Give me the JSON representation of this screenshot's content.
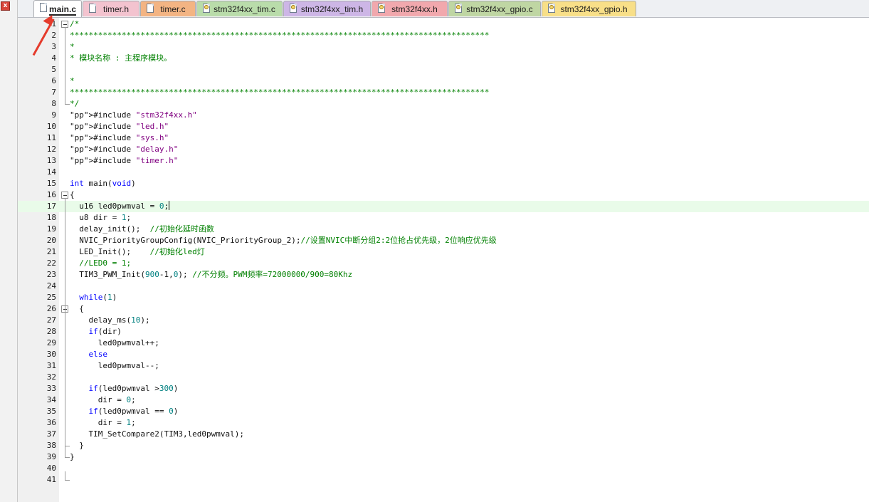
{
  "window": {
    "close_glyph": "x"
  },
  "tabs": [
    {
      "label": "main.c",
      "active": true,
      "color": "#ffffff",
      "icon": "file-icon"
    },
    {
      "label": "timer.h",
      "color": "#f3c3cf",
      "icon": "file-icon"
    },
    {
      "label": "timer.c",
      "color": "#f3b483",
      "icon": "file-icon"
    },
    {
      "label": "stm32f4xx_tim.c",
      "color": "#b9dcaa",
      "icon": "locked-file-icon"
    },
    {
      "label": "stm32f4xx_tim.h",
      "color": "#cdb6e6",
      "icon": "locked-file-icon"
    },
    {
      "label": "stm32f4xx.h",
      "color": "#f1a8ad",
      "icon": "locked-file-icon"
    },
    {
      "label": "stm32f4xx_gpio.c",
      "color": "#bfd6a3",
      "icon": "locked-file-icon"
    },
    {
      "label": "stm32f4xx_gpio.h",
      "color": "#f8df88",
      "icon": "locked-file-icon"
    }
  ],
  "annotation": {
    "arrow_color": "#e53b2c"
  },
  "editor": {
    "current_line": 17,
    "line_numbers": [
      "1",
      "2",
      "3",
      "4",
      "5",
      "6",
      "7",
      "8",
      "9",
      "10",
      "11",
      "12",
      "13",
      "14",
      "15",
      "16",
      "17",
      "18",
      "19",
      "20",
      "21",
      "22",
      "23",
      "24",
      "25",
      "26",
      "27",
      "28",
      "29",
      "30",
      "31",
      "32",
      "33",
      "34",
      "35",
      "36",
      "37",
      "38",
      "39",
      "40",
      "41"
    ],
    "lines": [
      "/*",
      "*****************************************************************************************",
      "*",
      "* 模块名称 : 主程序模块。",
      "",
      "*",
      "*****************************************************************************************",
      "*/",
      "#include \"stm32f4xx.h\"",
      "#include \"led.h\"",
      "#include \"sys.h\"",
      "#include \"delay.h\"",
      "#include \"timer.h\"",
      "",
      "int main(void)",
      "{",
      "  u16 led0pwmval = 0;",
      "  u8 dir = 1;",
      "  delay_init();  //初始化延时函数",
      "  NVIC_PriorityGroupConfig(NVIC_PriorityGroup_2);//设置NVIC中断分组2:2位抢占优先级，2位响应优先级",
      "  LED_Init();    //初始化led灯",
      "  //LED0 = 1;",
      "  TIM3_PWM_Init(900-1,0); //不分频。PWM频率=72000000/900=80Khz",
      "",
      "  while(1)",
      "  {",
      "    delay_ms(10);",
      "    if(dir)",
      "      led0pwmval++;",
      "    else",
      "      led0pwmval--;",
      "",
      "    if(led0pwmval >300)",
      "      dir = 0;",
      "    if(led0pwmval == 0)",
      "      dir = 1;",
      "    TIM_SetCompare2(TIM3,led0pwmval);",
      "  }",
      "}",
      "",
      ""
    ]
  }
}
